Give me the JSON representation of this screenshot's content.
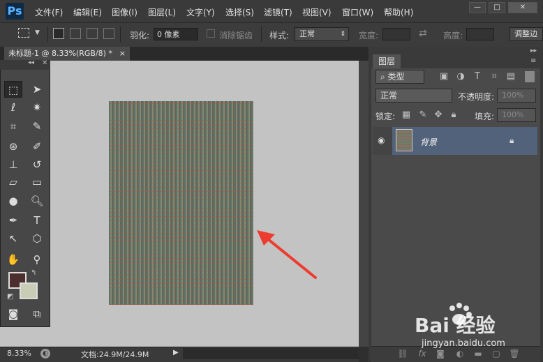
{
  "app": {
    "logo": "Ps"
  },
  "menu": [
    "文件(F)",
    "编辑(E)",
    "图像(I)",
    "图层(L)",
    "文字(Y)",
    "选择(S)",
    "滤镜(T)",
    "视图(V)",
    "窗口(W)",
    "帮助(H)"
  ],
  "window_buttons": [
    "—",
    "□",
    "✕"
  ],
  "options": {
    "feather_label": "羽化:",
    "feather_value": "0 像素",
    "antialias_label": "消除锯齿",
    "style_label": "样式:",
    "style_value": "正常",
    "width_label": "宽度:",
    "height_label": "高度:",
    "refine_label": "调整边"
  },
  "document": {
    "tab_title": "未标题-1 @ 8.33%(RGB/8) *",
    "tab_close": "×"
  },
  "status": {
    "zoom": "8.33%",
    "doc_info": "文档:24.9M/24.9M"
  },
  "layers_panel": {
    "tab": "图层",
    "filter_kind": "类型",
    "blend_mode": "正常",
    "opacity_label": "不透明度:",
    "opacity_value": "100%",
    "lock_label": "锁定:",
    "fill_label": "填充:",
    "fill_value": "100%",
    "layers": [
      {
        "name": "背景",
        "locked": true,
        "visible": true
      }
    ]
  },
  "colors": {
    "foreground": "#4c2e2e",
    "background": "#c9cdb5",
    "annotation_arrow": "#ee3b2f"
  },
  "watermark": {
    "brand": "Bai 经验",
    "domain": "jingyan.baidu.com"
  }
}
